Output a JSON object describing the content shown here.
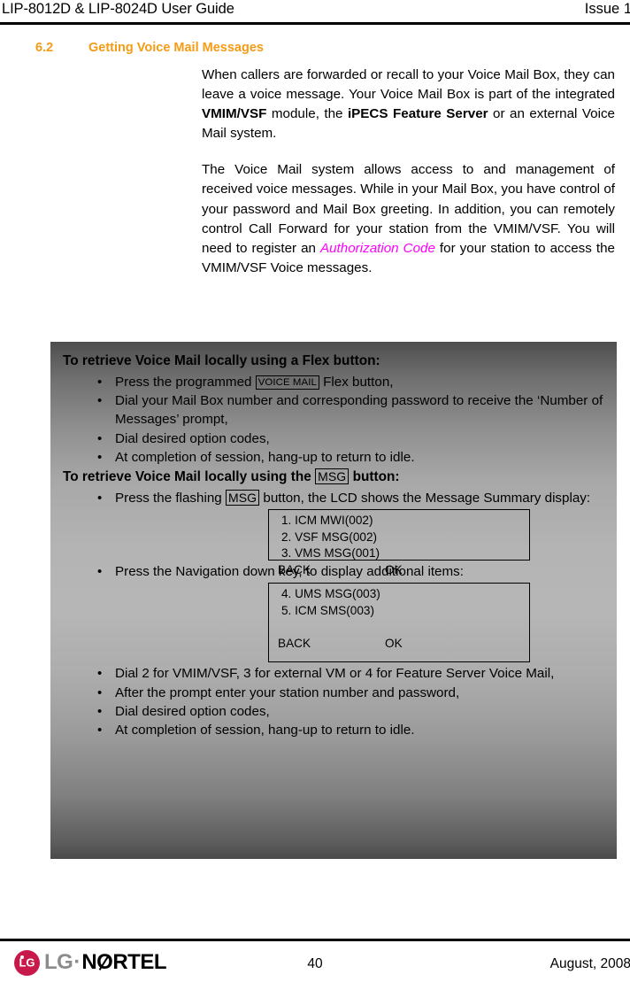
{
  "header": {
    "title": "LIP-8012D & LIP-8024D User Guide",
    "issue": "Issue 1"
  },
  "section": {
    "number": "6.2",
    "title": "Getting Voice Mail Messages"
  },
  "body": {
    "paragraph1_part1": "When callers are forwarded or recall to your Voice Mail Box, they can leave a voice message.  Your Voice Mail Box is part of the integrated ",
    "paragraph1_bold1": "VMIM/VSF",
    "paragraph1_part2": " module, the ",
    "paragraph1_bold2": "iPECS Feature Server",
    "paragraph1_part3": " or an external Voice Mail system.",
    "paragraph2_part1": "The Voice Mail system allows access to and management of received voice messages.  While in your Mail Box, you have control of your password and Mail Box greeting.  In addition, you can remotely control Call Forward for your station from the VMIM/VSF.  You will need to register an ",
    "paragraph2_italic": "Authorization Code",
    "paragraph2_part2": " for your station to access the VMIM/VSF Voice messages."
  },
  "panel": {
    "heading1": "To retrieve Voice Mail locally using a Flex button:",
    "flex_steps": [
      {
        "before": "Press the programmed ",
        "keycap": "VOICE MAIL",
        "after": " Flex button,"
      },
      {
        "before": "Dial your Mail Box number and corresponding password to receive the ‘Number of Messages’ prompt,",
        "keycap": "",
        "after": ""
      },
      {
        "before": "Dial desired option codes,",
        "keycap": "",
        "after": ""
      },
      {
        "before": "At completion of session, hang-up to return to idle.",
        "keycap": "",
        "after": ""
      }
    ],
    "heading2_before": "To retrieve Voice Mail locally using the ",
    "heading2_keycap": "MSG",
    "heading2_after": " button:",
    "msg_step1_before": "Press the flashing ",
    "msg_step1_keycap": "MSG",
    "msg_step1_after": " button, the LCD shows the Message Summary display:",
    "lcd1": {
      "lines": [
        "1. ICM MWI(002)",
        "2. VSF MSG(002)",
        "3. VMS MSG(001)"
      ],
      "softkey_back": "BACK",
      "softkey_ok": "OK"
    },
    "msg_step2": "Press the Navigation down key, to display additional items:",
    "lcd2": {
      "lines": [
        "4. UMS MSG(003)",
        "5. ICM SMS(003)"
      ],
      "softkey_back": "BACK",
      "softkey_ok": "OK"
    },
    "msg_steps_tail": [
      "Dial 2 for VMIM/VSF, 3 for external VM or 4 for Feature Server Voice Mail,",
      "After the prompt enter your station number and password,",
      "Dial desired option codes,",
      "At completion of session, hang-up to return to idle."
    ],
    "bullet_glyph": "•"
  },
  "footer": {
    "logo_lg": "LG",
    "logo_dot": "·",
    "logo_nortel_pre": "N",
    "logo_nortel_o": "O",
    "logo_nortel_post": "RTEL",
    "logo_badge": "LG",
    "page_number": "40",
    "date": "August, 2008"
  },
  "colors": {
    "heading_orange": "#F59B16",
    "authcode_magenta": "#FF00FF",
    "logo_crimson": "#C8194B",
    "panel_gradient_dark": "#4e4e4e",
    "panel_gradient_light": "#b6b6b6"
  }
}
